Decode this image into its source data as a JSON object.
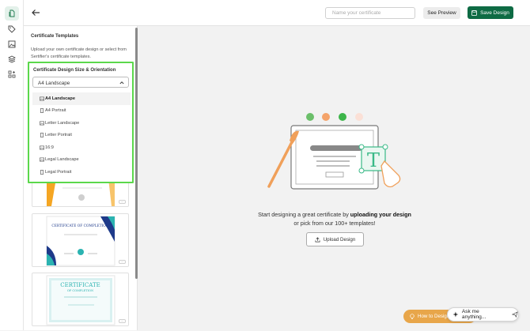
{
  "sidebar_icons": [
    "file-icon",
    "tag-icon",
    "image-icon",
    "layers-icon",
    "grid-plus-icon"
  ],
  "topbar": {
    "name_placeholder": "Name your certificate",
    "preview_label": "See Preview",
    "save_label": "Save Design"
  },
  "panel": {
    "title": "Certificate Templates",
    "description": "Upload your own certificate design or select from Sertifier's certificate templates.",
    "size_label": "Certificate Design Size & Orientation",
    "selected_size": "A4 Landscape",
    "options": [
      {
        "label": "A4 Landscape",
        "icon": "landscape-icon"
      },
      {
        "label": "A4 Portrait",
        "icon": "portrait-icon"
      },
      {
        "label": "Letter Landscape",
        "icon": "landscape-icon"
      },
      {
        "label": "Letter Portrait",
        "icon": "portrait-icon"
      },
      {
        "label": "16:9",
        "icon": "landscape-icon"
      },
      {
        "label": "Legal Landscape",
        "icon": "landscape-icon"
      },
      {
        "label": "Legal Portrait",
        "icon": "portrait-icon"
      }
    ],
    "templates": [
      {
        "title": "",
        "color": "#f5a623"
      },
      {
        "title": "CERTIFICATE OF COMPLETION",
        "color": "#1e3a8a"
      },
      {
        "title": "CERTIFICATE",
        "subtitle": "OF COMPLETION",
        "color": "#2bb3b1"
      }
    ]
  },
  "hero": {
    "line1_prefix": "Start designing a great certificate by ",
    "line1_bold": "uploading your design",
    "line2": "or pick from our 100+ templates!",
    "upload_label": "Upload Design",
    "dot_colors": [
      "#6bbf6a",
      "#f4a36a",
      "#3db54a",
      "#fbe0d6"
    ]
  },
  "footer": {
    "howto_label": "How to Design",
    "ask_label": "Ask me anything..."
  }
}
